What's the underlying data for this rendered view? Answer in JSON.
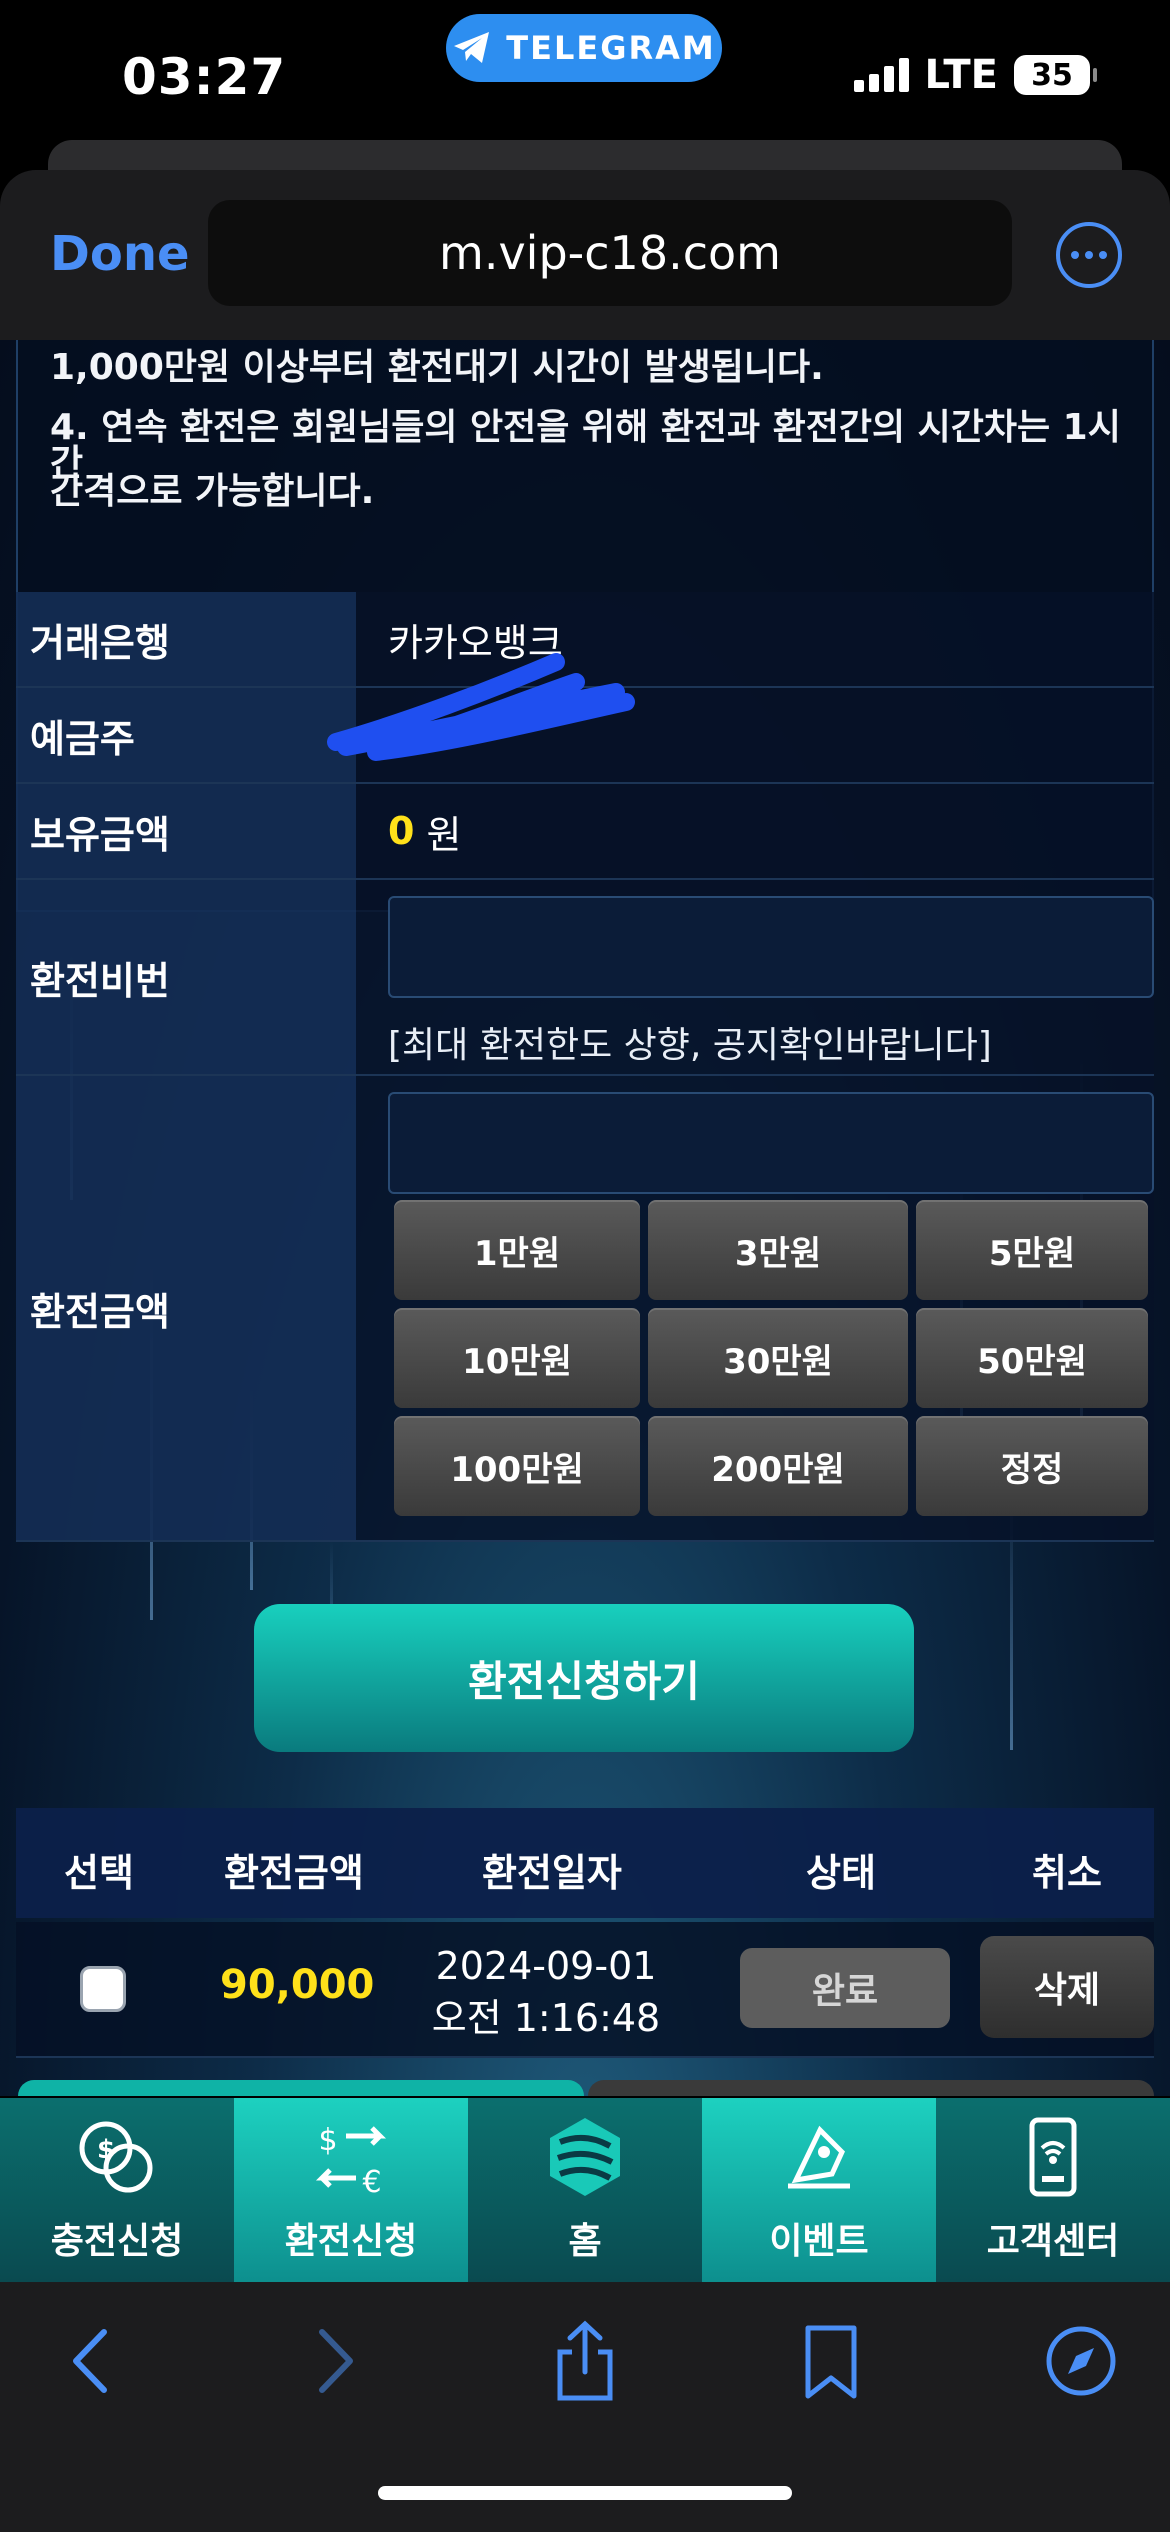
{
  "status_bar": {
    "time": "03:27",
    "pill_label": "TELEGRAM",
    "network": "LTE",
    "battery": "35"
  },
  "browser": {
    "done_label": "Done",
    "url": "m.vip-c18.com"
  },
  "notice": {
    "line1": "1,000만원 이상부터 환전대기 시간이 발생됩니다.",
    "line2": "4. 연속 환전은 회원님들의 안전을 위해 환전과 환전간의 시간차는 1시간",
    "line3": "간격으로 가능합니다."
  },
  "form": {
    "bank_label": "거래은행",
    "bank_value": "카카오뱅크",
    "holder_label": "예금주",
    "balance_label": "보유금액",
    "balance_value": "0",
    "balance_unit": "원",
    "password_label": "환전비번",
    "password_hint": "[최대 환전한도 상향, 공지확인바랍니다]",
    "amount_label": "환전금액",
    "amount_buttons": [
      "1만원",
      "3만원",
      "5만원",
      "10만원",
      "30만원",
      "50만원",
      "100만원",
      "200만원",
      "정정"
    ]
  },
  "submit_label": "환전신청하기",
  "history": {
    "headers": [
      "선택",
      "환전금액",
      "환전일자",
      "상태",
      "취소"
    ],
    "rows": [
      {
        "amount": "90,000",
        "date": "2024-09-01",
        "time": "오전 1:16:48",
        "status": "완료",
        "cancel": "삭제"
      }
    ]
  },
  "site_tabs": [
    {
      "label": "충전신청",
      "icon": "coins-icon"
    },
    {
      "label": "환전신청",
      "icon": "exchange-icon"
    },
    {
      "label": "홈",
      "icon": "logo-icon"
    },
    {
      "label": "이벤트",
      "icon": "gift-icon"
    },
    {
      "label": "고객센터",
      "icon": "phone-support-icon"
    }
  ],
  "colors": {
    "accent": "#18d0be",
    "highlight": "#ffe11a",
    "ios_blue": "#4a8ef5"
  }
}
